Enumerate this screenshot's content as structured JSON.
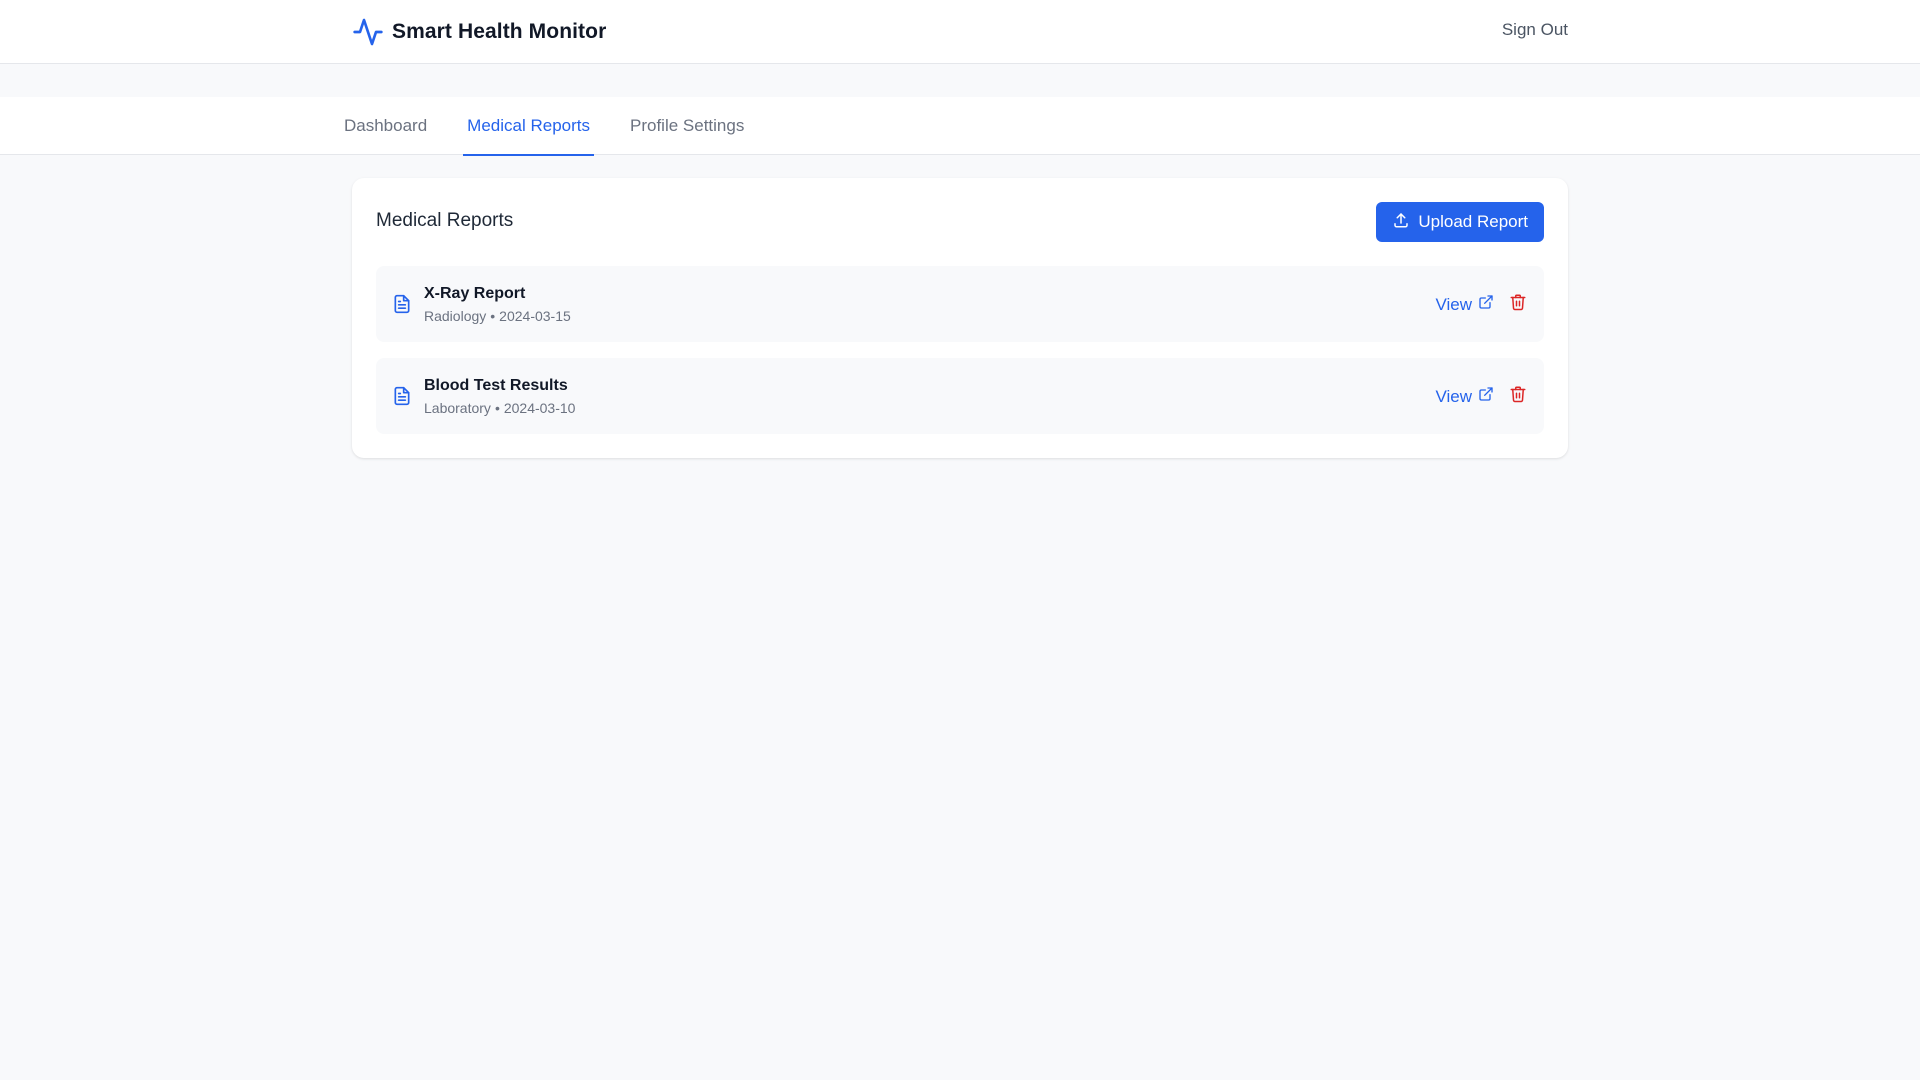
{
  "app": {
    "title": "Smart Health Monitor",
    "logo_icon": "heartbeat-icon",
    "sign_out_label": "Sign Out",
    "accent_color": "#2563eb",
    "danger_color": "#dc2626"
  },
  "nav": {
    "tabs": [
      {
        "label": "Dashboard",
        "active": false
      },
      {
        "label": "Medical Reports",
        "active": true
      },
      {
        "label": "Profile Settings",
        "active": false
      }
    ]
  },
  "reports_panel": {
    "title": "Medical Reports",
    "upload_label": "Upload Report",
    "upload_icon": "upload-icon",
    "items": [
      {
        "name": "X-Ray Report",
        "category": "Radiology",
        "separator": "•",
        "date": "2024-03-15",
        "view_label": "View",
        "icon": "document-icon"
      },
      {
        "name": "Blood Test Results",
        "category": "Laboratory",
        "separator": "•",
        "date": "2024-03-10",
        "view_label": "View",
        "icon": "document-icon"
      }
    ]
  }
}
